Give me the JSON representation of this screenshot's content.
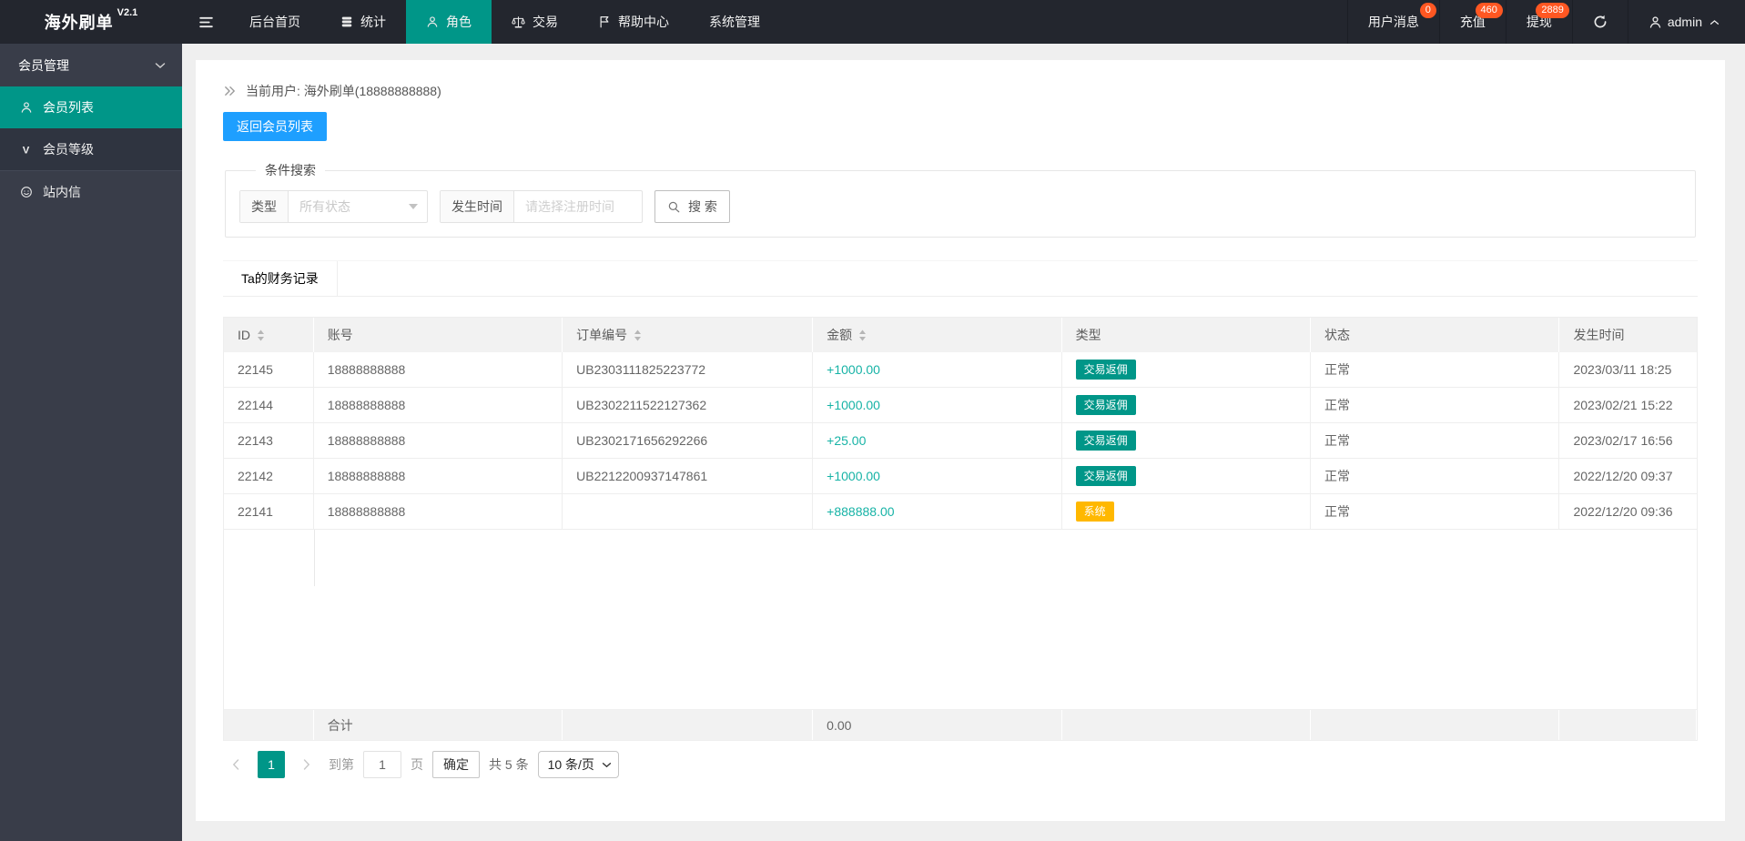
{
  "colors": {
    "accent_teal": "#009688",
    "primary_blue": "#1E9FFF",
    "badge_red": "#FF5722",
    "type_badge_teal": "#009688",
    "type_badge_yellow": "#FFB800",
    "amount_teal": "#17b3a6",
    "topbar_bg": "#23262e",
    "sidebar_bg": "#393D49"
  },
  "brand": {
    "title": "海外刷单",
    "version": "V2.1"
  },
  "topnav": {
    "items": [
      {
        "label": "后台首页"
      },
      {
        "label": "统计",
        "icon": "database-icon"
      },
      {
        "label": "角色",
        "icon": "person-icon",
        "active": true
      },
      {
        "label": "交易",
        "icon": "scales-icon"
      },
      {
        "label": "帮助中心",
        "icon": "flag-icon"
      },
      {
        "label": "系统管理"
      }
    ],
    "right_items": [
      {
        "label": "用户消息",
        "badge": "0"
      },
      {
        "label": "充值",
        "badge": "460"
      },
      {
        "label": "提现",
        "badge": "2889"
      }
    ],
    "username": "admin"
  },
  "sidebar": {
    "group_label": "会员管理",
    "items": [
      {
        "label": "会员列表",
        "icon": "person-icon",
        "active": true
      },
      {
        "label": "会员等级",
        "icon": "v-icon"
      },
      {
        "label": "站内信",
        "icon": "message-icon",
        "toplevel": true
      }
    ]
  },
  "page": {
    "breadcrumb": "当前用户: 海外刷单(18888888888)",
    "back_button": "返回会员列表"
  },
  "search": {
    "legend": "条件搜索",
    "type_label": "类型",
    "type_value": "所有状态",
    "time_label": "发生时间",
    "time_placeholder": "请选择注册时间",
    "button_label": "搜 索"
  },
  "tabs": {
    "active": "Ta的财务记录"
  },
  "table": {
    "headers": [
      {
        "label": "ID",
        "sortable": true
      },
      {
        "label": "账号"
      },
      {
        "label": "订单编号",
        "sortable": true
      },
      {
        "label": "金额",
        "sortable": true
      },
      {
        "label": "类型"
      },
      {
        "label": "状态"
      },
      {
        "label": "发生时间"
      }
    ],
    "rows": [
      {
        "id": "22145",
        "account": "18888888888",
        "order_no": "UB2303111825223772",
        "amount": "+1000.00",
        "type": "交易返佣",
        "type_color": "teal",
        "status": "正常",
        "time": "2023/03/11 18:25"
      },
      {
        "id": "22144",
        "account": "18888888888",
        "order_no": "UB2302211522127362",
        "amount": "+1000.00",
        "type": "交易返佣",
        "type_color": "teal",
        "status": "正常",
        "time": "2023/02/21 15:22"
      },
      {
        "id": "22143",
        "account": "18888888888",
        "order_no": "UB2302171656292266",
        "amount": "+25.00",
        "type": "交易返佣",
        "type_color": "teal",
        "status": "正常",
        "time": "2023/02/17 16:56"
      },
      {
        "id": "22142",
        "account": "18888888888",
        "order_no": "UB2212200937147861",
        "amount": "+1000.00",
        "type": "交易返佣",
        "type_color": "teal",
        "status": "正常",
        "time": "2022/12/20 09:37"
      },
      {
        "id": "22141",
        "account": "18888888888",
        "order_no": "",
        "amount": "+888888.00",
        "type": "系统",
        "type_color": "yellow",
        "status": "正常",
        "time": "2022/12/20 09:36"
      }
    ],
    "total_row": {
      "label": "合计",
      "amount": "0.00"
    }
  },
  "pagination": {
    "current_page": "1",
    "goto_prefix": "到第",
    "goto_value": "1",
    "goto_suffix": "页",
    "confirm_label": "确定",
    "total_label": "共 5 条",
    "page_size_label": "10 条/页"
  }
}
